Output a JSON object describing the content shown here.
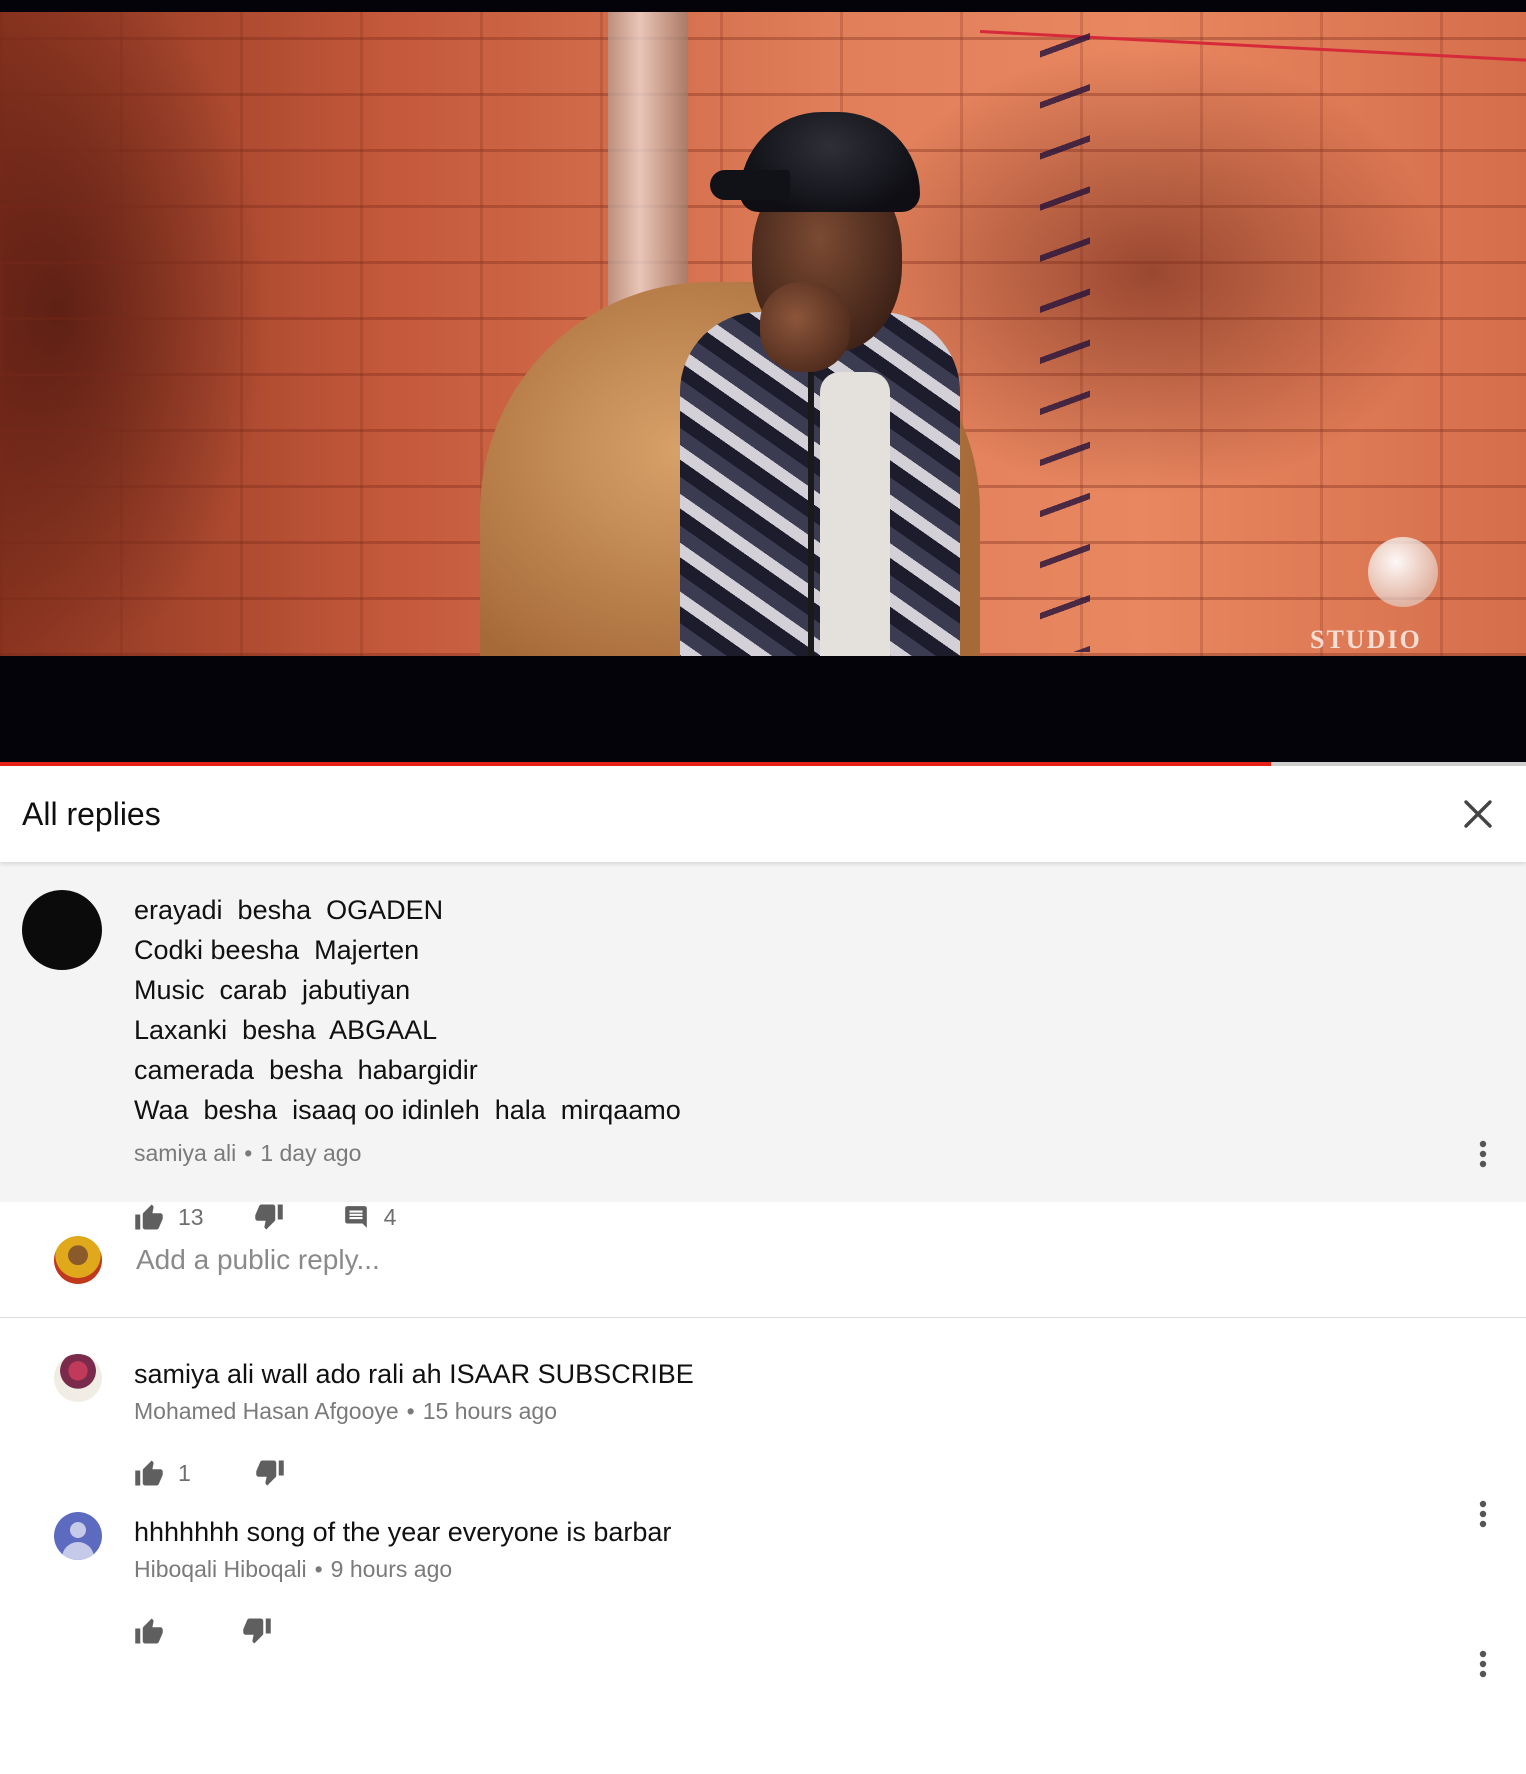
{
  "player": {
    "watermark": "STUDIO LIIBAAN",
    "progress": 0.833
  },
  "replies_panel": {
    "title": "All replies",
    "close_icon": "close-icon"
  },
  "top_comment": {
    "lines": [
      "erayadi  besha  OGADEN",
      "Codki beesha  Majerten",
      "Music  carab  jabutiyan",
      "Laxanki  besha  ABGAAL",
      "camerada  besha  habargidir",
      "Waa  besha  isaaq oo idinleh  hala  mirqaamo"
    ],
    "author": "samiya ali",
    "time": "1 day ago",
    "likes": "13",
    "replies": "4"
  },
  "add_reply": {
    "placeholder": "Add a public reply..."
  },
  "replies": [
    {
      "text": "samiya ali wall ado rali ah ISAAR SUBSCRIBE",
      "author": "Mohamed Hasan Afgooye",
      "time": "15 hours ago",
      "likes": "1"
    },
    {
      "text": "hhhhhhh song of the year everyone is barbar",
      "author": "Hiboqali Hiboqali",
      "time": "9 hours ago",
      "likes": ""
    }
  ],
  "colors": {
    "progress": "#e62117",
    "meta_text": "#7a7a7a",
    "highlight_bg": "#f4f4f4"
  }
}
